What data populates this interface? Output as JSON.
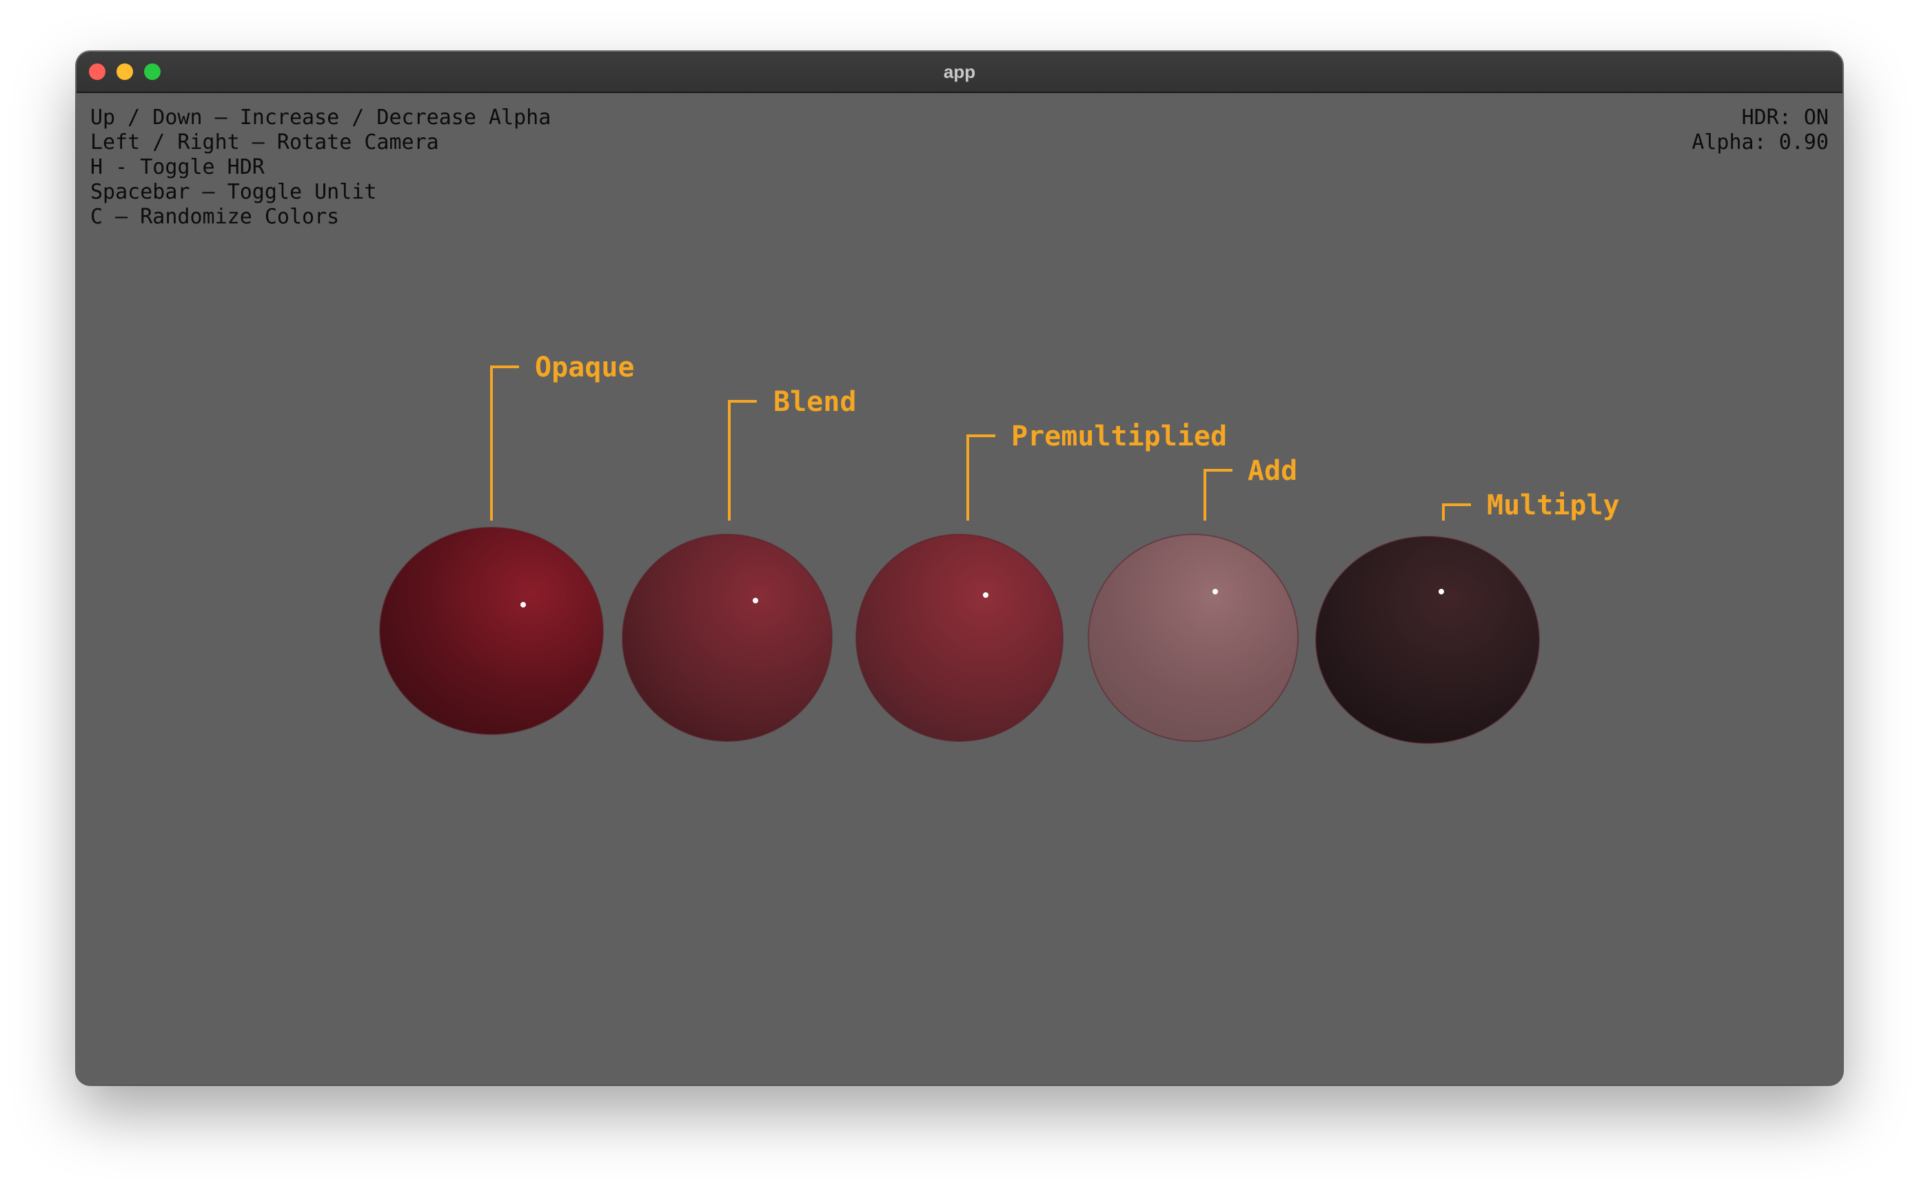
{
  "window": {
    "title": "app",
    "traffic_colors": {
      "close": "#ff5f57",
      "minimize": "#febc2e",
      "zoom": "#28c840"
    }
  },
  "help_lines": [
    "Up / Down — Increase / Decrease Alpha",
    "Left / Right — Rotate Camera",
    "H - Toggle HDR",
    "Spacebar — Toggle Unlit",
    "C — Randomize Colors"
  ],
  "status": {
    "hdr": "HDR: ON",
    "alpha": "Alpha: 0.90"
  },
  "spheres": [
    {
      "label": "Opaque"
    },
    {
      "label": "Blend"
    },
    {
      "label": "Premultiplied"
    },
    {
      "label": "Add"
    },
    {
      "label": "Multiply"
    }
  ],
  "colors": {
    "label": "#f5a623",
    "sphere": "#7a1a24",
    "background": "#606060",
    "floor_light": "#6e6e6e",
    "floor_dark": "#0d0d0d"
  }
}
